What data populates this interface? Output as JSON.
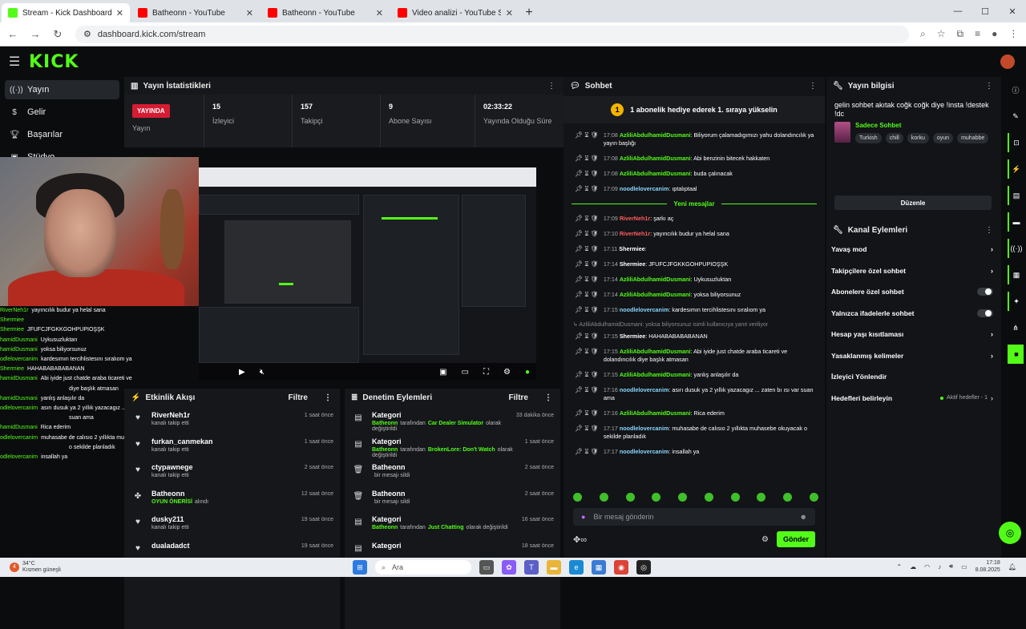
{
  "browser": {
    "tabs": [
      {
        "title": "Stream - Kick Dashboard",
        "color": "#53fc18",
        "active": true
      },
      {
        "title": "Batheonn - YouTube",
        "color": "#ff0000",
        "active": false
      },
      {
        "title": "Batheonn - YouTube",
        "color": "#ff0000",
        "active": false
      },
      {
        "title": "Video analizi - YouTube Studio",
        "color": "#ff0000",
        "active": false
      }
    ],
    "url": "dashboard.kick.com/stream"
  },
  "brand": {
    "logo": "KICK",
    "accent": "#53fc18"
  },
  "sidebar": {
    "items": [
      {
        "label": "Yayın",
        "icon": "broadcast-icon"
      },
      {
        "label": "Gelir",
        "icon": "dollar-icon"
      },
      {
        "label": "Başarılar",
        "icon": "trophy-icon"
      },
      {
        "label": "Stüdyo",
        "icon": "camera-icon"
      }
    ]
  },
  "overlay_chat": [
    {
      "name": "RiverNeh1r",
      "text": "yayıncılık budur ya helal sana"
    },
    {
      "name": "Shermiee",
      "text": ""
    },
    {
      "name": "Shermiee",
      "text": "JFUFCJFGKKGOHPUPIOŞŞK"
    },
    {
      "name": "hamidDusmani",
      "text": "Uykusuzluktan"
    },
    {
      "name": "hamidDusmani",
      "text": "yoksa biliyorsunuz"
    },
    {
      "name": "odlelovercanim",
      "text": "kardesımın tercihlistesını sıralıom ya"
    },
    {
      "name": "Shermiee",
      "text": "HAHABABABABANAN"
    },
    {
      "name": "hamidDusmani",
      "text": "Abi iyide just chatde araba ticareti ve"
    },
    {
      "name": "",
      "text": "diye başlık atmasan"
    },
    {
      "name": "hamidDusmani",
      "text": "yanlış anlaşılır da"
    },
    {
      "name": "odlelovercanim",
      "text": "asırı dusuk ya 2 yıllık yazacagız ... zaten bı ısı var"
    },
    {
      "name": "",
      "text": "suan ama"
    },
    {
      "name": "hamidDusmani",
      "text": "Rica ederim"
    },
    {
      "name": "odlelovercanim",
      "text": "muhasabe de calısıo 2 yıllıkta muhasebe okuyacak"
    },
    {
      "name": "",
      "text": "o sekilde planladık"
    },
    {
      "name": "odlelovercanim",
      "text": "insallah ya"
    }
  ],
  "stats": {
    "title": "Yayın İstatistikleri",
    "live_badge": "YAYINDA",
    "live_label": "Yayın",
    "viewers": "15",
    "viewers_label": "İzleyici",
    "followers": "157",
    "followers_label": "Takipçi",
    "subs": "9",
    "subs_label": "Abone Sayısı",
    "uptime": "02:33:22",
    "uptime_label": "Yayında Olduğu Süre"
  },
  "activity": {
    "title": "Etkinlik Akışı",
    "filter": "Filtre",
    "items": [
      {
        "icon": "heart-icon",
        "who": "RiverNeh1r",
        "sub": "kanalı takip etti",
        "highlight": "",
        "time": "1 saat önce"
      },
      {
        "icon": "heart-icon",
        "who": "furkan_canmekan",
        "sub": "kanalı takip etti",
        "highlight": "",
        "time": "1 saat önce"
      },
      {
        "icon": "heart-icon",
        "who": "ctypawnege",
        "sub": "kanalı takip etti",
        "highlight": "",
        "time": "2 saat önce"
      },
      {
        "icon": "tag-icon",
        "who": "Batheonn",
        "sub": "alındı",
        "highlight": "OYUN ÖNERİSİ",
        "time": "12 saat önce"
      },
      {
        "icon": "heart-icon",
        "who": "dusky211",
        "sub": "kanalı takip etti",
        "highlight": "",
        "time": "19 saat önce"
      },
      {
        "icon": "heart-icon",
        "who": "dualadadct",
        "sub": "",
        "highlight": "",
        "time": "19 saat önce"
      }
    ]
  },
  "moderation": {
    "title": "Denetim Eylemleri",
    "filter": "Filtre",
    "items": [
      {
        "icon": "category-icon",
        "who": "Kategori",
        "pre": "Batheonn",
        "mid": "tarafından",
        "highlight": "Car Dealer Simulator",
        "post": "olarak değiştirildi",
        "time": "33 dakika önce"
      },
      {
        "icon": "category-icon",
        "who": "Kategori",
        "pre": "Batheonn",
        "mid": "tarafından",
        "highlight": "BrokenLore: Don't Watch",
        "post": "olarak değiştirildi",
        "time": "1 saat önce"
      },
      {
        "icon": "trash-icon",
        "who": "Batheonn",
        "pre": "",
        "mid": "",
        "highlight": "",
        "post": "bir mesajı sildi",
        "time": "2 saat önce"
      },
      {
        "icon": "trash-icon",
        "who": "Batheonn",
        "pre": "",
        "mid": "",
        "highlight": "",
        "post": "bir mesajı sildi",
        "time": "2 saat önce"
      },
      {
        "icon": "category-icon",
        "who": "Kategori",
        "pre": "Batheonn",
        "mid": "tarafından",
        "highlight": "Just Chatting",
        "post": "olarak değiştirildi",
        "time": "16 saat önce"
      },
      {
        "icon": "category-icon",
        "who": "Kategori",
        "pre": "",
        "mid": "",
        "highlight": "",
        "post": "",
        "time": "18 saat önce"
      }
    ]
  },
  "chat": {
    "title": "Sohbet",
    "pinned_num": "1",
    "pinned_text": "1 abonelik hediye ederek 1. sıraya yükselin",
    "new_messages": "Yeni mesajlar",
    "input_placeholder": "Bir mesaj gönderin",
    "send": "Gönder",
    "messages_before": [
      {
        "time": "17:08",
        "user": "AzliliAbdulhamidDusmani",
        "color": "green",
        "text": "Biliyorum çalamadıgımızı yahu dolandıncılık ya yayın başlığı"
      },
      {
        "time": "17:08",
        "user": "AzliliAbdulhamidDusmani",
        "color": "green",
        "text": "Abi benzinin bitecek hakkaten"
      },
      {
        "time": "17:08",
        "user": "AzliliAbdulhamidDusmani",
        "color": "green",
        "text": "buda çalınacak"
      },
      {
        "time": "17:09",
        "user": "noodlelovercanim",
        "color": "blue",
        "text": "ıptalıptaal"
      }
    ],
    "messages_after": [
      {
        "time": "17:09",
        "user": "RiverNeh1r",
        "color": "red",
        "text": "şarkı aç"
      },
      {
        "time": "17:10",
        "user": "RiverNeh1r",
        "color": "red",
        "text": "yayıncılık budur ya helal sana"
      },
      {
        "time": "17:11",
        "user": "Shermiee",
        "color": "white",
        "text": ""
      },
      {
        "time": "17:14",
        "user": "Shermiee",
        "color": "white",
        "text": "JFUFCJFGKKGOHPUPIOŞŞK"
      },
      {
        "time": "17:14",
        "user": "AzliliAbdulhamidDusmani",
        "color": "green",
        "text": "Uykusuzluktan"
      },
      {
        "time": "17:14",
        "user": "AzliliAbdulhamidDusmani",
        "color": "green",
        "text": "yoksa biliyorsunuz"
      },
      {
        "time": "17:15",
        "user": "noodlelovercanim",
        "color": "blue",
        "text": "kardesımın tercihlistesını sıralıom ya"
      }
    ],
    "reply_line": "↳ AzliliAbdulhamidDusmani: yoksa biliyorsunuz isimli kullanıcıya yanıt veriliyor",
    "messages_end": [
      {
        "time": "17:15",
        "user": "Shermiee",
        "color": "white",
        "text": "HAHABABABABANAN"
      },
      {
        "time": "17:15",
        "user": "AzliliAbdulhamidDusmani",
        "color": "green",
        "text": "Abi iyide just chatde araba ticareti ve dolandıncılık diye başlık atmasan"
      },
      {
        "time": "17:15",
        "user": "AzliliAbdulhamidDusmani",
        "color": "green",
        "text": "yanlış anlaşılır da"
      },
      {
        "time": "17:16",
        "user": "noodlelovercanim",
        "color": "blue",
        "text": "asırı dusuk ya 2 yıllık yazacagız ... zaten bı ısı var suan ama"
      },
      {
        "time": "17:16",
        "user": "AzliliAbdulhamidDusmani",
        "color": "green",
        "text": "Rica ederim"
      },
      {
        "time": "17:17",
        "user": "noodlelovercanim",
        "color": "blue",
        "text": "muhasabe de calısıo 2 yıllıkta muhasebe okuyacak o sekilde planladık"
      },
      {
        "time": "17:17",
        "user": "noodlelovercanim",
        "color": "blue",
        "text": "insallah ya"
      }
    ]
  },
  "stream_info": {
    "title": "Yayın bilgisi",
    "text": "gelin sohbet akıtak coğk coğk diye !insta !destek !dc",
    "category": "Sadece Sohbet",
    "tags": [
      "Turkish",
      "chill",
      "korku",
      "oyun",
      "muhabbe"
    ],
    "edit": "Düzenle"
  },
  "channel_actions": {
    "title": "Kanal Eylemleri",
    "items": [
      {
        "label": "Yavaş mod",
        "kind": "chevron"
      },
      {
        "label": "Takipçilere özel sohbet",
        "kind": "chevron"
      },
      {
        "label": "Abonelere özel sohbet",
        "kind": "toggle"
      },
      {
        "label": "Yalnızca ifadelerle sohbet",
        "kind": "toggle"
      },
      {
        "label": "Hesap yaşı kısıtlaması",
        "kind": "chevron"
      },
      {
        "label": "Yasaklanmış kelimeler",
        "kind": "chevron"
      },
      {
        "label": "İzleyici Yönlendir",
        "kind": "none"
      },
      {
        "label": "Hedefleri belirleyin",
        "kind": "meta",
        "meta": "Aktif hedefler - 1"
      }
    ]
  },
  "taskbar": {
    "temp": "34°C",
    "weather": "Kısmen güneşli",
    "search": "Ara",
    "time": "17:18",
    "date": "8.08.2025",
    "weather_badge": "4"
  }
}
